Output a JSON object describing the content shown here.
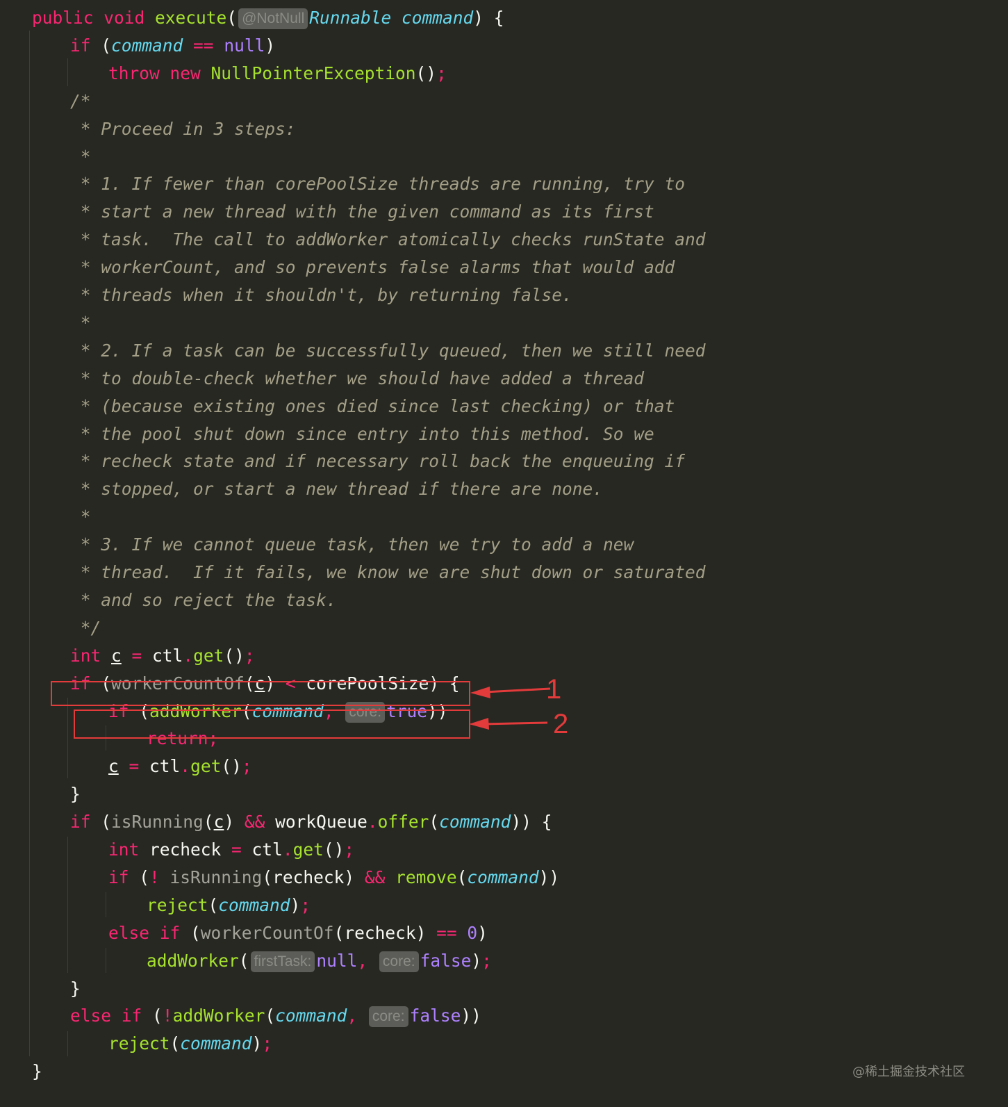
{
  "lines": [
    {
      "tokens": [
        [
          "kw",
          "public "
        ],
        [
          "kw",
          "void "
        ],
        [
          "fn",
          "execute"
        ],
        [
          "pun",
          "("
        ],
        [
          "hint",
          "@NotNull"
        ],
        [
          "type",
          "Runnable "
        ],
        [
          "var",
          "command"
        ],
        [
          "pun",
          ") {"
        ]
      ]
    },
    {
      "tokens": [
        [
          "kw",
          "if "
        ],
        [
          "pun",
          "("
        ],
        [
          "var",
          "command"
        ],
        [
          "op",
          " == "
        ],
        [
          "null",
          "null"
        ],
        [
          "pun",
          ")"
        ]
      ]
    },
    {
      "tokens": [
        [
          "kw",
          "throw "
        ],
        [
          "kw",
          "new "
        ],
        [
          "fn",
          "NullPointerException"
        ],
        [
          "pun",
          "()"
        ],
        [
          "op",
          ";"
        ]
      ]
    },
    {
      "tokens": [
        [
          "cmt",
          "/*"
        ]
      ]
    },
    {
      "tokens": [
        [
          "cmt",
          " * Proceed in 3 steps:"
        ]
      ]
    },
    {
      "tokens": [
        [
          "cmt",
          " *"
        ]
      ]
    },
    {
      "tokens": [
        [
          "cmt",
          " * 1. If fewer than corePoolSize threads are running, try to"
        ]
      ]
    },
    {
      "tokens": [
        [
          "cmt",
          " * start a new thread with the given command as its first"
        ]
      ]
    },
    {
      "tokens": [
        [
          "cmt",
          " * task.  The call to addWorker atomically checks runState and"
        ]
      ]
    },
    {
      "tokens": [
        [
          "cmt",
          " * workerCount, and so prevents false alarms that would add"
        ]
      ]
    },
    {
      "tokens": [
        [
          "cmt",
          " * threads when it shouldn't, by returning false."
        ]
      ]
    },
    {
      "tokens": [
        [
          "cmt",
          " *"
        ]
      ]
    },
    {
      "tokens": [
        [
          "cmt",
          " * 2. If a task can be successfully queued, then we still need"
        ]
      ]
    },
    {
      "tokens": [
        [
          "cmt",
          " * to double-check whether we should have added a thread"
        ]
      ]
    },
    {
      "tokens": [
        [
          "cmt",
          " * (because existing ones died since last checking) or that"
        ]
      ]
    },
    {
      "tokens": [
        [
          "cmt",
          " * the pool shut down since entry into this method. So we"
        ]
      ]
    },
    {
      "tokens": [
        [
          "cmt",
          " * recheck state and if necessary roll back the enqueuing if"
        ]
      ]
    },
    {
      "tokens": [
        [
          "cmt",
          " * stopped, or start a new thread if there are none."
        ]
      ]
    },
    {
      "tokens": [
        [
          "cmt",
          " *"
        ]
      ]
    },
    {
      "tokens": [
        [
          "cmt",
          " * 3. If we cannot queue task, then we try to add a new"
        ]
      ]
    },
    {
      "tokens": [
        [
          "cmt",
          " * thread.  If it fails, we know we are shut down or saturated"
        ]
      ]
    },
    {
      "tokens": [
        [
          "cmt",
          " * and so reject the task."
        ]
      ]
    },
    {
      "tokens": [
        [
          "cmt",
          " */"
        ]
      ]
    },
    {
      "tokens": [
        [
          "kw",
          "int "
        ],
        [
          "u",
          "c"
        ],
        [
          "op",
          " = "
        ],
        [
          "id",
          "ctl"
        ],
        [
          "op",
          "."
        ],
        [
          "fn",
          "get"
        ],
        [
          "pun",
          "()"
        ],
        [
          "op",
          ";"
        ]
      ]
    },
    {
      "tokens": [
        [
          "kw",
          "if "
        ],
        [
          "pun",
          "("
        ],
        [
          "call",
          "workerCountOf"
        ],
        [
          "pun",
          "("
        ],
        [
          "u",
          "c"
        ],
        [
          "pun",
          ") "
        ],
        [
          "op",
          "< "
        ],
        [
          "id",
          "corePoolSize"
        ],
        [
          "pun",
          ") {"
        ]
      ]
    },
    {
      "tokens": [
        [
          "kw",
          "if "
        ],
        [
          "pun",
          "("
        ],
        [
          "fn",
          "addWorker"
        ],
        [
          "pun",
          "("
        ],
        [
          "var",
          "command"
        ],
        [
          "op",
          ", "
        ],
        [
          "hint",
          "core:"
        ],
        [
          "null",
          "true"
        ],
        [
          "pun",
          "))"
        ]
      ]
    },
    {
      "tokens": [
        [
          "kw",
          "return"
        ],
        [
          "op",
          ";"
        ]
      ]
    },
    {
      "tokens": [
        [
          "u",
          "c"
        ],
        [
          "op",
          " = "
        ],
        [
          "id",
          "ctl"
        ],
        [
          "op",
          "."
        ],
        [
          "fn",
          "get"
        ],
        [
          "pun",
          "()"
        ],
        [
          "op",
          ";"
        ]
      ]
    },
    {
      "tokens": [
        [
          "pun",
          "}"
        ]
      ]
    },
    {
      "tokens": [
        [
          "kw",
          "if "
        ],
        [
          "pun",
          "("
        ],
        [
          "call",
          "isRunning"
        ],
        [
          "pun",
          "("
        ],
        [
          "u",
          "c"
        ],
        [
          "pun",
          ") "
        ],
        [
          "op",
          "&& "
        ],
        [
          "id",
          "workQueue"
        ],
        [
          "op",
          "."
        ],
        [
          "fn",
          "offer"
        ],
        [
          "pun",
          "("
        ],
        [
          "var",
          "command"
        ],
        [
          "pun",
          ")) {"
        ]
      ]
    },
    {
      "tokens": [
        [
          "kw",
          "int "
        ],
        [
          "id",
          "recheck"
        ],
        [
          "op",
          " = "
        ],
        [
          "id",
          "ctl"
        ],
        [
          "op",
          "."
        ],
        [
          "fn",
          "get"
        ],
        [
          "pun",
          "()"
        ],
        [
          "op",
          ";"
        ]
      ]
    },
    {
      "tokens": [
        [
          "kw",
          "if "
        ],
        [
          "pun",
          "("
        ],
        [
          "op",
          "! "
        ],
        [
          "call",
          "isRunning"
        ],
        [
          "pun",
          "("
        ],
        [
          "id",
          "recheck"
        ],
        [
          "pun",
          ") "
        ],
        [
          "op",
          "&& "
        ],
        [
          "fn",
          "remove"
        ],
        [
          "pun",
          "("
        ],
        [
          "var",
          "command"
        ],
        [
          "pun",
          "))"
        ]
      ]
    },
    {
      "tokens": [
        [
          "fn",
          "reject"
        ],
        [
          "pun",
          "("
        ],
        [
          "var",
          "command"
        ],
        [
          "pun",
          ")"
        ],
        [
          "op",
          ";"
        ]
      ]
    },
    {
      "tokens": [
        [
          "kw",
          "else "
        ],
        [
          "kw",
          "if "
        ],
        [
          "pun",
          "("
        ],
        [
          "call",
          "workerCountOf"
        ],
        [
          "pun",
          "("
        ],
        [
          "id",
          "recheck"
        ],
        [
          "pun",
          ") "
        ],
        [
          "op",
          "== "
        ],
        [
          "num",
          "0"
        ],
        [
          "pun",
          ")"
        ]
      ]
    },
    {
      "tokens": [
        [
          "fn",
          "addWorker"
        ],
        [
          "pun",
          "("
        ],
        [
          "hint",
          "firstTask:"
        ],
        [
          "null",
          "null"
        ],
        [
          "op",
          ", "
        ],
        [
          "hint",
          "core:"
        ],
        [
          "null",
          "false"
        ],
        [
          "pun",
          ")"
        ],
        [
          "op",
          ";"
        ]
      ]
    },
    {
      "tokens": [
        [
          "pun",
          "}"
        ]
      ]
    },
    {
      "tokens": [
        [
          "kw",
          "else "
        ],
        [
          "kw",
          "if "
        ],
        [
          "pun",
          "("
        ],
        [
          "op",
          "!"
        ],
        [
          "fn",
          "addWorker"
        ],
        [
          "pun",
          "("
        ],
        [
          "var",
          "command"
        ],
        [
          "op",
          ", "
        ],
        [
          "hint",
          "core:"
        ],
        [
          "null",
          "false"
        ],
        [
          "pun",
          "))"
        ]
      ]
    },
    {
      "tokens": [
        [
          "fn",
          "reject"
        ],
        [
          "pun",
          "("
        ],
        [
          "var",
          "command"
        ],
        [
          "pun",
          ")"
        ],
        [
          "op",
          ";"
        ]
      ]
    },
    {
      "tokens": [
        [
          "pun",
          "}"
        ]
      ]
    }
  ],
  "annotations": {
    "label_1": "1",
    "label_2": "2"
  },
  "watermark": "@稀土掘金技术社区",
  "colors": {
    "background": "#272822",
    "keyword": "#f92672",
    "function": "#a6e22e",
    "parameter": "#66d9ef",
    "literal": "#ae81ff",
    "comment": "#a49f87",
    "text": "#f8f8f2",
    "annotation": "#e33b3b"
  }
}
